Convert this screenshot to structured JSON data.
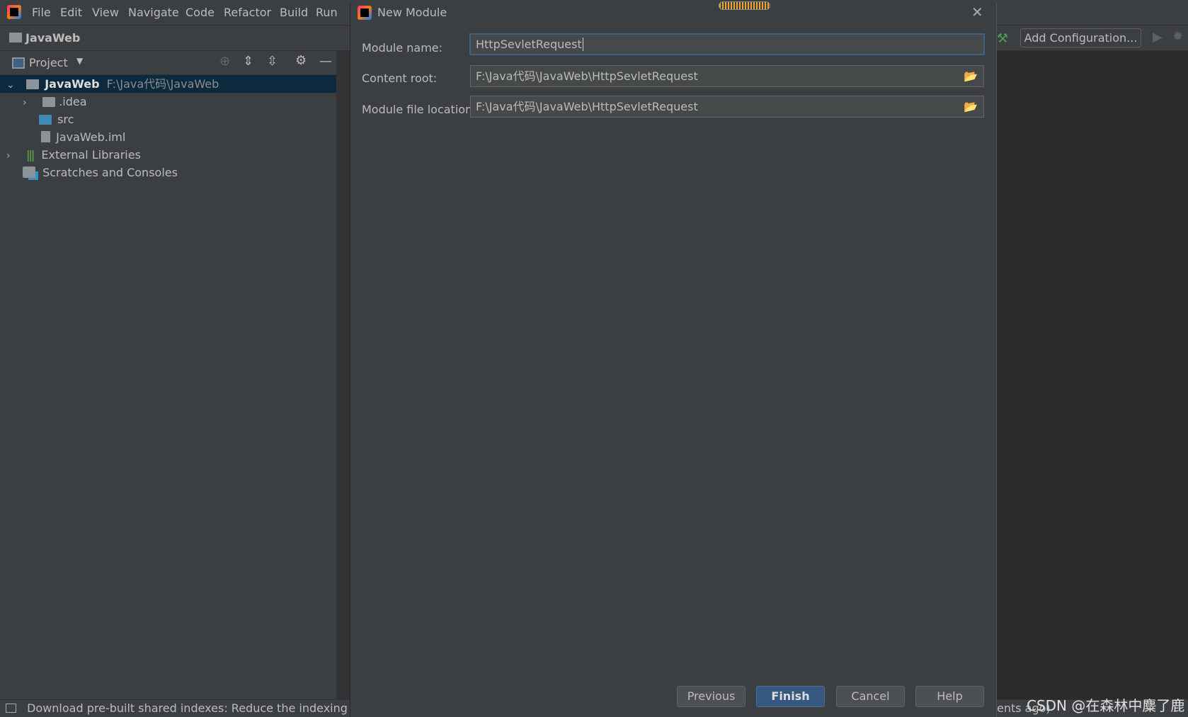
{
  "menu": [
    "File",
    "Edit",
    "View",
    "Navigate",
    "Code",
    "Refactor",
    "Build",
    "Run"
  ],
  "project_name": "JavaWeb",
  "project_panel": {
    "title": "Project"
  },
  "tree": [
    {
      "label": "JavaWeb",
      "path": "F:\\Java代码\\JavaWeb"
    },
    {
      "label": ".idea"
    },
    {
      "label": "src"
    },
    {
      "label": "JavaWeb.iml"
    },
    {
      "label": "External Libraries"
    },
    {
      "label": "Scratches and Consoles"
    }
  ],
  "toolbar": {
    "add_configuration": "Add Configuration..."
  },
  "dialog": {
    "title": "New Module",
    "fields": [
      {
        "label": "Module name:",
        "value": "HttpSevletRequest"
      },
      {
        "label": "Content root:",
        "value": "F:\\Java代码\\JavaWeb\\HttpSevletRequest"
      },
      {
        "label": "Module file location:",
        "value": "F:\\Java代码\\JavaWeb\\HttpSevletRequest"
      }
    ],
    "buttons": {
      "previous": "Previous",
      "finish": "Finish",
      "cancel": "Cancel",
      "help": "Help"
    }
  },
  "status": {
    "message": "Download pre-built shared indexes: Reduce the indexing time a",
    "right_fragment": "ents ago)"
  },
  "watermark": "CSDN @在森林中麋了鹿",
  "colors": {
    "accent": "#365880",
    "selection": "#0d293e",
    "focus_border": "#3d6185"
  }
}
